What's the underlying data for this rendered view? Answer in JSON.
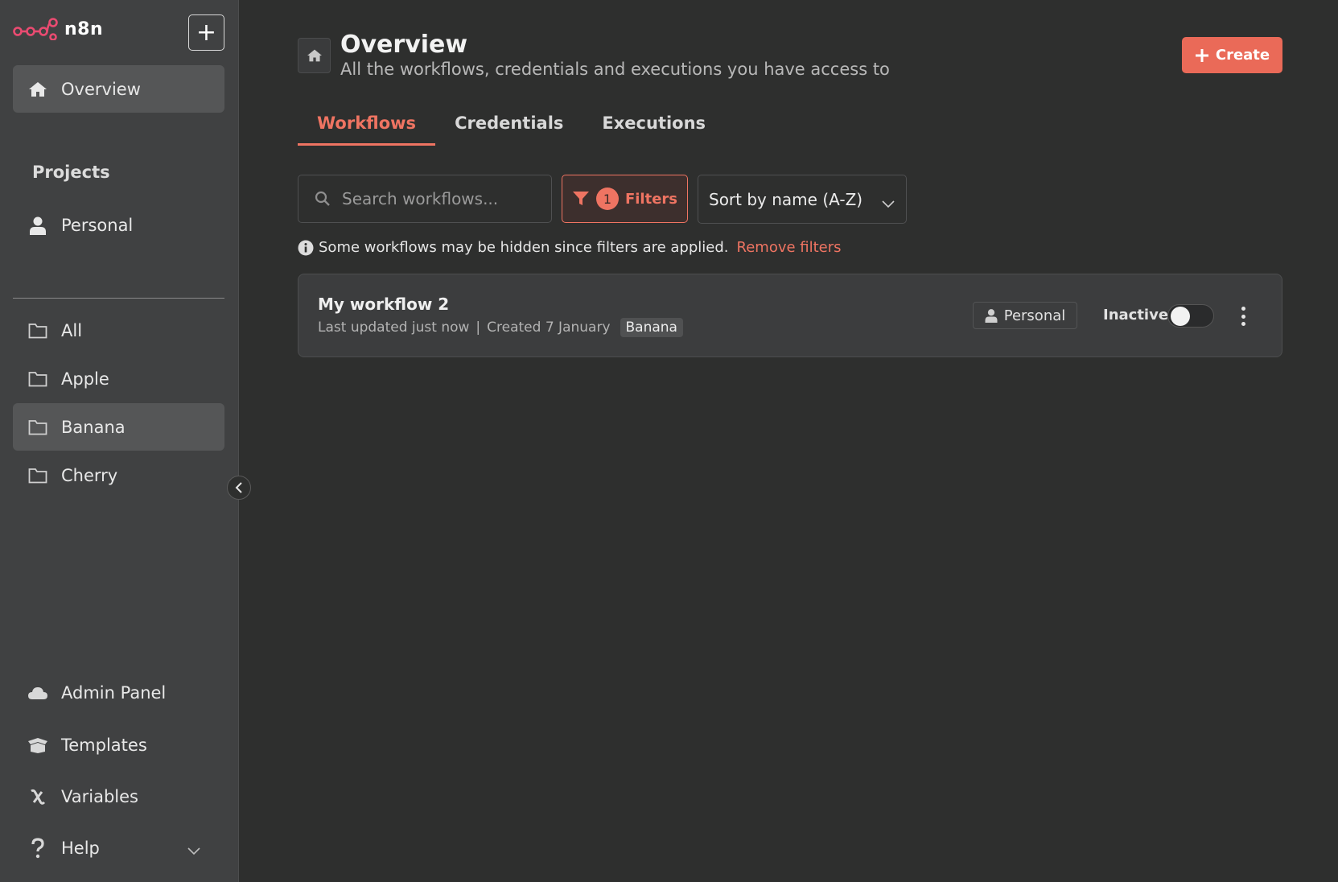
{
  "brand": {
    "name": "n8n",
    "accent": "#ea6a58"
  },
  "sidebar": {
    "new_button_label": "+",
    "overview_label": "Overview",
    "projects_title": "Projects",
    "personal_label": "Personal",
    "folders": [
      {
        "label": "All",
        "active": false
      },
      {
        "label": "Apple",
        "active": false
      },
      {
        "label": "Banana",
        "active": true
      },
      {
        "label": "Cherry",
        "active": false
      }
    ],
    "bottom_items": [
      {
        "label": "Admin Panel",
        "icon": "cloud-icon"
      },
      {
        "label": "Templates",
        "icon": "box-icon"
      },
      {
        "label": "Variables",
        "icon": "variable-icon"
      },
      {
        "label": "Help",
        "icon": "help-icon"
      }
    ]
  },
  "header": {
    "title": "Overview",
    "subtitle": "All the workflows, credentials and executions you have access to",
    "create_label": "Create"
  },
  "tabs": [
    {
      "label": "Workflows",
      "active": true
    },
    {
      "label": "Credentials",
      "active": false
    },
    {
      "label": "Executions",
      "active": false
    }
  ],
  "toolbar": {
    "search_placeholder": "Search workflows...",
    "filters_count": "1",
    "filters_label": "Filters",
    "sort_value": "Sort by name (A-Z)"
  },
  "notice": {
    "text": "Some workflows may be hidden since filters are applied.",
    "link": "Remove filters"
  },
  "workflows": [
    {
      "name": "My workflow 2",
      "updated": "Last updated just now",
      "separator": "|",
      "created": "Created 7 January",
      "tag": "Banana",
      "owner": "Personal",
      "status": "Inactive",
      "active": false
    }
  ]
}
